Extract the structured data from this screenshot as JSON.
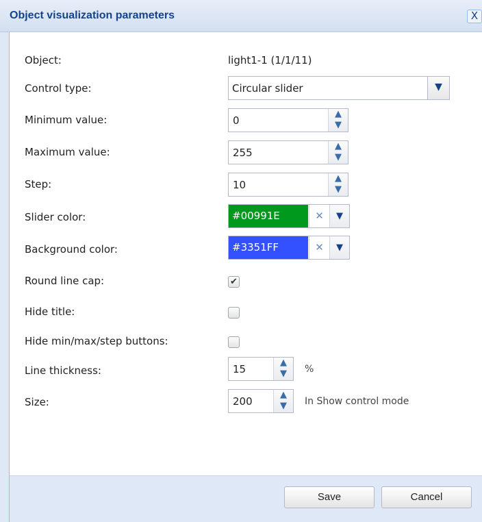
{
  "dialog": {
    "title": "Object visualization parameters",
    "close_icon": "close-icon",
    "close_label": "X"
  },
  "form": {
    "object": {
      "label": "Object:",
      "value": "light1-1 (1/1/11)"
    },
    "control_type": {
      "label": "Control type:",
      "value": "Circular slider"
    },
    "minimum": {
      "label": "Minimum value:",
      "value": "0"
    },
    "maximum": {
      "label": "Maximum value:",
      "value": "255"
    },
    "step": {
      "label": "Step:",
      "value": "10"
    },
    "slider_color": {
      "label": "Slider color:",
      "value": "#00991E",
      "color": "#00991E"
    },
    "background_color": {
      "label": "Background color:",
      "value": "#3351FF",
      "color": "#3351FF"
    },
    "round_line_cap": {
      "label": "Round line cap:",
      "checked": true
    },
    "hide_title": {
      "label": "Hide title:",
      "checked": false
    },
    "hide_buttons": {
      "label": "Hide min/max/step buttons:",
      "checked": false
    },
    "line_thickness": {
      "label": "Line thickness:",
      "value": "15",
      "suffix": "%"
    },
    "size": {
      "label": "Size:",
      "value": "200",
      "suffix": "In Show control mode"
    }
  },
  "footer": {
    "save_label": "Save",
    "cancel_label": "Cancel"
  },
  "colors": {
    "title_text": "#15428b",
    "panel_border": "#99bbe8",
    "footer_bg": "#dfe8f6"
  }
}
